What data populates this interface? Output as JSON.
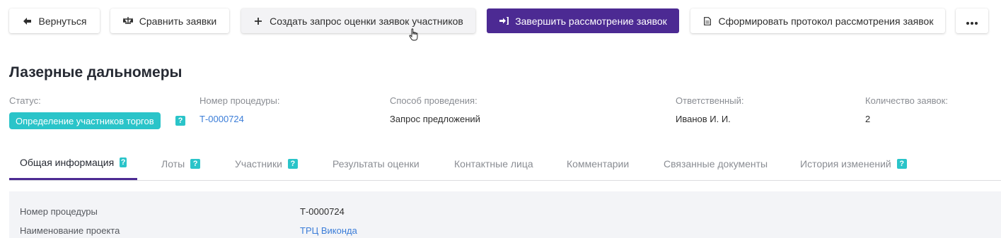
{
  "toolbar": {
    "back_label": "Вернуться",
    "compare_label": "Сравнить заявки",
    "create_request_label": "Создать запрос оценки заявок участников",
    "finish_label": "Завершить рассмотрение заявок",
    "protocol_label": "Сформировать протокол рассмотрения заявок"
  },
  "page_title": "Лазерные дальномеры",
  "meta": {
    "status_label": "Статус:",
    "status_value": "Определение участников торгов",
    "procedure_label": "Номер процедуры:",
    "procedure_value": "Т-0000724",
    "method_label": "Способ проведения:",
    "method_value": "Запрос предложений",
    "responsible_label": "Ответственный:",
    "responsible_value": "Иванов И. И.",
    "count_label": "Количество заявок:",
    "count_value": "2"
  },
  "help_glyph": "?",
  "tabs": [
    {
      "label": "Общая информация",
      "help": true,
      "active": true
    },
    {
      "label": "Лоты",
      "help": true
    },
    {
      "label": "Участники",
      "help": true
    },
    {
      "label": "Результаты оценки"
    },
    {
      "label": "Контактные лица"
    },
    {
      "label": "Комментарии"
    },
    {
      "label": "Связанные документы"
    },
    {
      "label": "История изменений",
      "help": true
    }
  ],
  "details": [
    {
      "label": "Номер процедуры",
      "value": "Т-0000724"
    },
    {
      "label": "Наименование проекта",
      "value": "ТРЦ Виконда"
    }
  ],
  "colors": {
    "primary": "#4c2a93",
    "accent_teal": "#2ac4c9",
    "link": "#3b7dd8"
  },
  "icons": {
    "back": "arrow-left-icon",
    "compare": "scales-icon",
    "create": "plus-icon",
    "finish": "sign-in-icon",
    "protocol": "document-icon",
    "more": "ellipsis-icon"
  }
}
